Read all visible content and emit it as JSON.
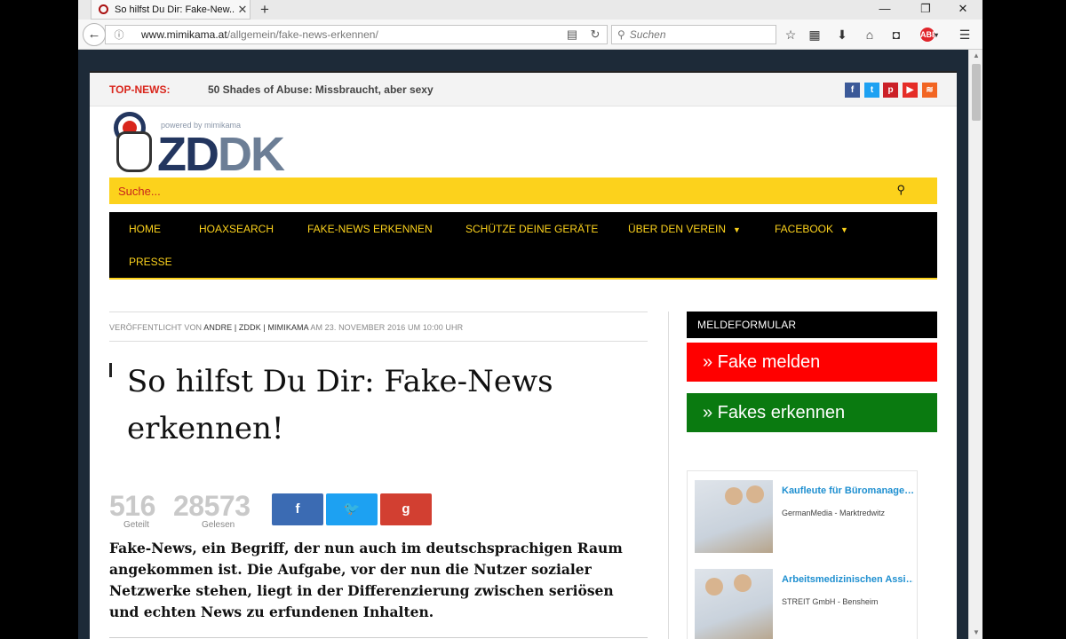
{
  "browser": {
    "tab_title": "So hilfst Du Dir: Fake-New...",
    "url_host": "www.mimikama.at",
    "url_path": "/allgemein/fake-news-erkennen/",
    "search_placeholder": "Suchen"
  },
  "topnews": {
    "label": "TOP-NEWS:",
    "headline": "50 Shades of Abuse: Missbraucht, aber sexy",
    "social": [
      {
        "icon": "facebook-icon",
        "glyph": "f",
        "color": "#3b5998"
      },
      {
        "icon": "twitter-icon",
        "glyph": "t",
        "color": "#1da1f2"
      },
      {
        "icon": "pinterest-icon",
        "glyph": "p",
        "color": "#cb2027"
      },
      {
        "icon": "youtube-icon",
        "glyph": "▶",
        "color": "#e52d27"
      },
      {
        "icon": "rss-icon",
        "glyph": "≋",
        "color": "#f26522"
      }
    ]
  },
  "logo": {
    "powered_by": "powered by mimikama",
    "text_a": "ZD",
    "text_b": "DK"
  },
  "site_search": {
    "placeholder": "Suche..."
  },
  "nav": [
    {
      "label": "HOME",
      "has_menu": false
    },
    {
      "label": "HOAXSEARCH",
      "has_menu": false
    },
    {
      "label": "FAKE-NEWS ERKENNEN",
      "has_menu": false
    },
    {
      "label": "SCHÜTZE DEINE GERÄTE",
      "has_menu": false
    },
    {
      "label": "ÜBER DEN VEREIN",
      "has_menu": true
    },
    {
      "label": "FACEBOOK",
      "has_menu": true
    },
    {
      "label": "PRESSE",
      "has_menu": false
    }
  ],
  "article": {
    "meta_prefix": "VERÖFFENTLICHT VON",
    "author": "ANDRE | ZDDK | MIMIKAMA",
    "meta_suffix": "AM 23. NOVEMBER 2016 UM 10:00 UHR",
    "title": "So hilfst Du Dir: Fake-News erkennen!",
    "shares_count": "516",
    "shares_label": "Geteilt",
    "reads_count": "28573",
    "reads_label": "Gelesen",
    "share_buttons": [
      {
        "icon": "facebook-icon",
        "glyph": "f",
        "color": "#3b6bb3"
      },
      {
        "icon": "twitter-icon",
        "glyph": "🐦",
        "color": "#1da1f2"
      },
      {
        "icon": "google-plus-icon",
        "glyph": "g",
        "color": "#d23f31"
      }
    ],
    "intro": "Fake-News, ein Begriff, der nun auch im deutschsprachigen Raum angekommen ist. Die Aufgabe, vor der nun die Nutzer sozialer Netzwerke stehen, liegt in der Differenzierung zwischen seriösen und echten News zu erfundenen Inhalten."
  },
  "sidebar": {
    "heading": "MELDEFORMULAR",
    "btn_report": "» Fake melden",
    "btn_report_color": "#ff0000",
    "btn_learn": "» Fakes erkennen",
    "btn_learn_color": "#0a7a10",
    "ads": [
      {
        "headline": "Kaufleute für Büromanage…",
        "source": "GermanMedia - Marktredwitz"
      },
      {
        "headline": "Arbeitsmedizinischen Assi…",
        "source": "STREIT GmbH - Bensheim"
      }
    ]
  }
}
